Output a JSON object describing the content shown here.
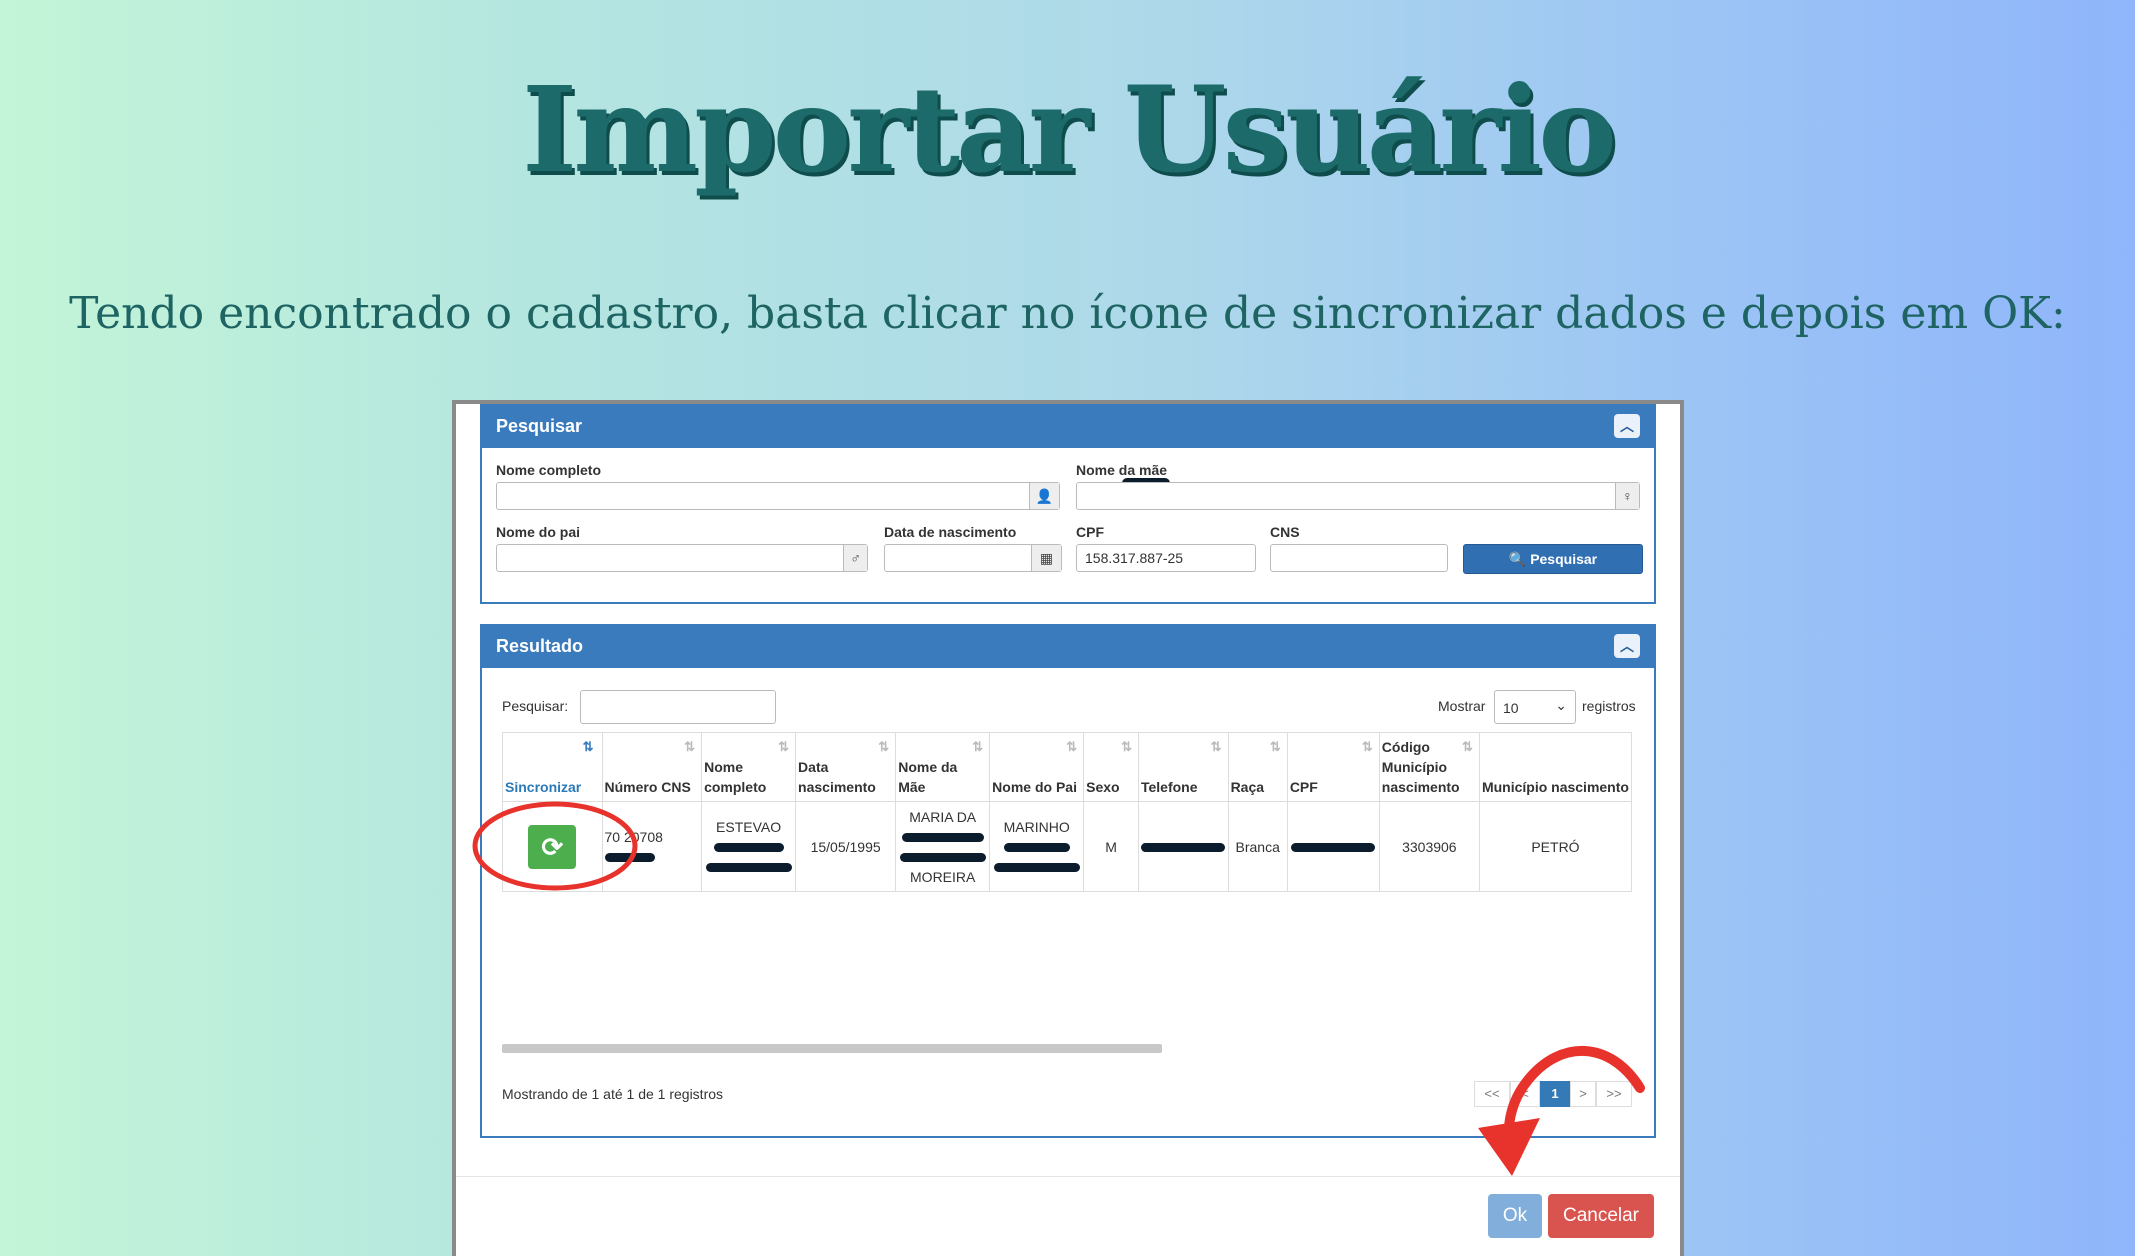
{
  "slide": {
    "title": "Importar Usuário",
    "subtitle": "Tendo encontrado o cadastro, basta clicar no ícone de sincronizar dados e depois em OK:"
  },
  "search_panel": {
    "header": "Pesquisar",
    "fields": {
      "nome_completo": {
        "label": "Nome completo",
        "value": ""
      },
      "nome_mae": {
        "label": "Nome da mãe",
        "value": ""
      },
      "nome_pai": {
        "label": "Nome do pai",
        "value": ""
      },
      "data_nascimento": {
        "label": "Data de nascimento",
        "value": ""
      },
      "cpf": {
        "label": "CPF",
        "value": "158.317.887-25"
      },
      "cns": {
        "label": "CNS",
        "value": ""
      }
    },
    "search_button": "Pesquisar"
  },
  "result_panel": {
    "header": "Resultado",
    "filter_label": "Pesquisar:",
    "show_label": "Mostrar",
    "page_size": "10",
    "records_label": "registros",
    "columns": [
      "Sincronizar",
      "Número CNS",
      "Nome completo",
      "Data nascimento",
      "Nome da Mãe",
      "Nome do Pai",
      "Sexo",
      "Telefone",
      "Raça",
      "CPF",
      "Código Município nascimento",
      "Município nascimento"
    ],
    "row": {
      "cns_prefix": "70 20708",
      "nome": "ESTEVAO",
      "data_nascimento": "15/05/1995",
      "mae_first": "MARIA DA",
      "mae_last": "MOREIRA",
      "pai_first": "MARINHO",
      "sexo": "M",
      "raca": "Branca",
      "codigo_municipio": "3303906",
      "municipio": "PETRÓ"
    },
    "info": "Mostrando de 1 até 1 de 1 registros",
    "pagination": {
      "first": "<<",
      "prev": "<",
      "current": "1",
      "next": ">",
      "last": ">>"
    }
  },
  "footer": {
    "ok": "Ok",
    "cancel": "Cancelar"
  },
  "colors": {
    "panel_blue": "#3a7bbd",
    "sync_green": "#4cae4c",
    "cancel_red": "#d9534f",
    "annotation_red": "#e8322c"
  }
}
